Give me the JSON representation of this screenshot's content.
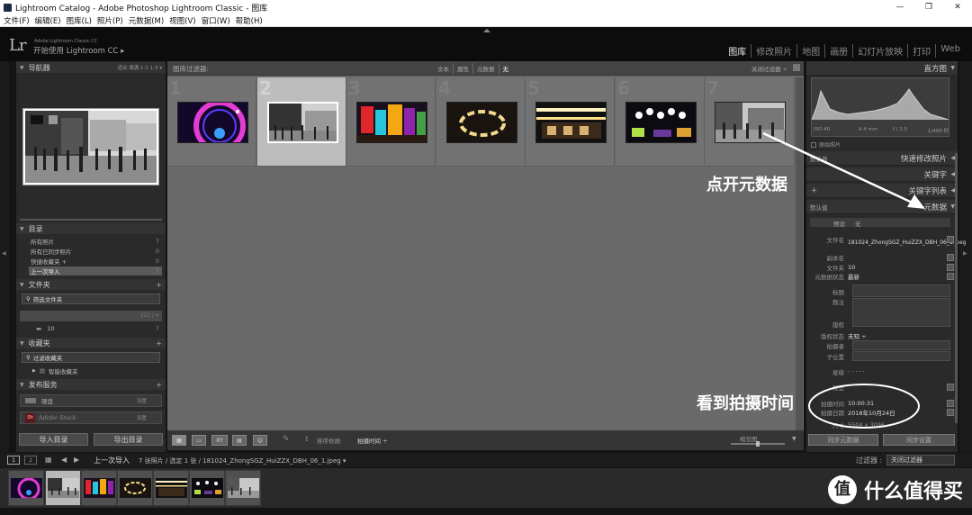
{
  "window": {
    "title": "Lightroom Catalog - Adobe Photoshop Lightroom Classic - 图库",
    "controls": [
      "—",
      "❐",
      "✕"
    ]
  },
  "menu": [
    "文件(F)",
    "编辑(E)",
    "图库(L)",
    "照片(P)",
    "元数据(M)",
    "视图(V)",
    "窗口(W)",
    "帮助(H)"
  ],
  "identity": {
    "logo": "Lr",
    "small": "Adobe Lightroom Classic CC",
    "main": "开始使用 Lightroom CC ▸"
  },
  "modules": [
    "图库",
    "修改照片",
    "地图",
    "画册",
    "幻灯片放映",
    "打印",
    "Web"
  ],
  "navigator": {
    "title": "导航器",
    "zoom": "适合  填满  1:1  1:3 ▾"
  },
  "catalog": {
    "title": "目录",
    "items": [
      {
        "label": "所有照片",
        "count": "7"
      },
      {
        "label": "所有已同步照片",
        "count": "0"
      },
      {
        "label": "快捷收藏夹 +",
        "count": "0"
      },
      {
        "label": "上一次导入",
        "count": "7"
      }
    ]
  },
  "folders": {
    "title": "文件夹",
    "filter": "筛选文件夹",
    "volume": "222 / ▾",
    "folder": {
      "label": "10",
      "count": "7"
    }
  },
  "collections": {
    "title": "收藏夹",
    "filter": "过滤收藏夹",
    "smart": "智能收藏夹"
  },
  "publish": {
    "title": "发布服务",
    "items": [
      {
        "label": "硬盘",
        "action": "设置"
      },
      {
        "label": "Adobe Stock",
        "badge": "St",
        "action": "设置"
      }
    ]
  },
  "buttons": {
    "import": "导入目录",
    "export": "导出目录"
  },
  "filterbar": {
    "label": "图库过滤器:",
    "tabs": [
      "文本",
      "属性",
      "元数据",
      "无"
    ],
    "right": "关闭过滤器 ÷"
  },
  "grid": {
    "cells": [
      {
        "num": "1",
        "selected": false,
        "art": "ferris"
      },
      {
        "num": "2",
        "selected": true,
        "art": "street"
      },
      {
        "num": "3",
        "selected": false,
        "art": "neon"
      },
      {
        "num": "4",
        "selected": false,
        "art": "ring"
      },
      {
        "num": "5",
        "selected": false,
        "art": "hall"
      },
      {
        "num": "6",
        "selected": false,
        "art": "lamps"
      },
      {
        "num": "7",
        "selected": false,
        "art": "bw"
      }
    ]
  },
  "toolbar": {
    "sort_label": "排序依据:",
    "sort_value": "拍摄时间 ÷",
    "thumb_label": "缩览图"
  },
  "histogram": {
    "title": "直方图",
    "iso": "ISO 40",
    "focal": "4.4 mm",
    "aperture": "f / 2.0",
    "shutter": "1/400 秒",
    "original": "原始照片"
  },
  "quick_develop": {
    "preset": "默认值",
    "title": "快速修改照片"
  },
  "keywords": {
    "title": "关键字"
  },
  "keyword_list": {
    "title": "关键字列表"
  },
  "metadata": {
    "preset": "默认值",
    "title": "元数据",
    "preset_label": "预设",
    "preset_value": "无",
    "rows": [
      {
        "k": "文件名",
        "v": "181024_ZhongSGZ_HuiZZX_DBH_06_1.jpeg"
      },
      {
        "k": "副本名",
        "v": ""
      },
      {
        "k": "文件夹",
        "v": "10"
      },
      {
        "k": "元数据状态",
        "v": "最新"
      },
      {
        "k": "标题",
        "v": ""
      },
      {
        "k": "题注",
        "v": ""
      },
      {
        "k": "版权",
        "v": ""
      },
      {
        "k": "版权状态",
        "v": "未知 ÷"
      },
      {
        "k": "拍摄者",
        "v": ""
      },
      {
        "k": "子位置",
        "v": ""
      },
      {
        "k": "星级",
        "v": "·  ·  ·  ·  ·"
      },
      {
        "k": "标签",
        "v": ""
      },
      {
        "k": "拍摄时间",
        "v": "10:00:31"
      },
      {
        "k": "拍摄日期",
        "v": "2018年10月24日"
      },
      {
        "k": "尺寸",
        "v": "5504 x 3096"
      }
    ]
  },
  "sync": {
    "metadata": "同步元数据",
    "settings": "同步设置"
  },
  "filmstrip": {
    "pages": [
      "1",
      "2"
    ],
    "source": "上一次导入",
    "count": "7 张照片 / 选定 1 张 / 181024_ZhongSGZ_HuiZZX_DBH_06_1.jpeg ▾",
    "filter_label": "过滤器 :",
    "filter_value": "关闭过滤器"
  },
  "annotations": {
    "open_meta": "点开元数据",
    "see_time": "看到拍摄时间"
  },
  "watermark": {
    "logo": "值",
    "text": "什么值得买"
  },
  "colors": {
    "panel": "#2a2a2a",
    "grid": "#6a6a6a",
    "selected_cell": "#bdbdbd",
    "annotation": "#ffffff"
  }
}
